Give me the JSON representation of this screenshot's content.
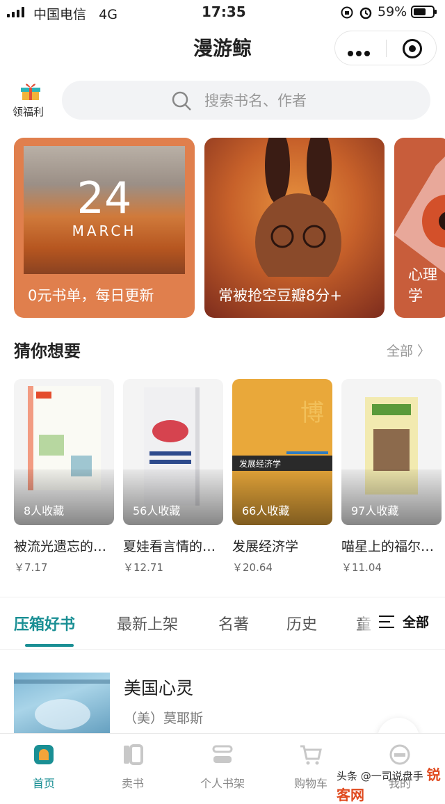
{
  "status": {
    "carrier": "中国电信",
    "network": "4G",
    "time": "17:35",
    "battery": "59%"
  },
  "nav": {
    "title": "漫游鲸"
  },
  "gift": {
    "label": "领福利"
  },
  "search": {
    "placeholder": "搜索书名、作者"
  },
  "banners": [
    {
      "caption": "0元书单，每日更新",
      "day": "24",
      "month": "MARCH"
    },
    {
      "caption": "常被抢空豆瓣8分+"
    },
    {
      "caption": "心理学"
    }
  ],
  "recommend": {
    "title": "猜你想要",
    "all_label": "全部",
    "books": [
      {
        "name": "被流光遗忘的故事",
        "price": "￥7.17",
        "favorites": "8人收藏"
      },
      {
        "name": "夏娃看言情的时候",
        "price": "￥12.71",
        "favorites": "56人收藏"
      },
      {
        "name": "发展经济学",
        "price": "￥20.64",
        "favorites": "66人收藏"
      },
      {
        "name": "喵星上的福尔摩斯",
        "price": "￥11.04",
        "favorites": "97人收藏"
      }
    ]
  },
  "tabs": {
    "items": [
      "压箱好书",
      "最新上架",
      "名著",
      "历史",
      "童"
    ],
    "active_index": 0,
    "all_label": "全部"
  },
  "list": [
    {
      "title": "美国心灵",
      "author": "（美）莫耶斯"
    }
  ],
  "bottom_nav": [
    {
      "label": "首页",
      "active": true
    },
    {
      "label": "卖书"
    },
    {
      "label": "个人书架"
    },
    {
      "label": "购物车"
    },
    {
      "label": "我的"
    }
  ],
  "watermark": {
    "text": "头条 @一司说盘手",
    "logo": "锐客网"
  },
  "colors": {
    "accent": "#1a8f94",
    "banner1": "#e07f4d"
  }
}
